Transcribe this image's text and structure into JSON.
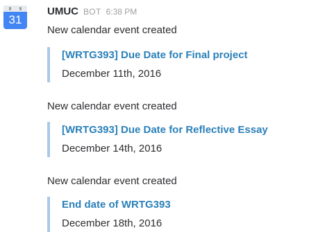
{
  "avatar": {
    "day": "31"
  },
  "header": {
    "sender": "UMUC",
    "bot_badge": "BOT",
    "time": "6:38 PM"
  },
  "messages": [
    {
      "text": "New calendar event created",
      "event_title": "[WRTG393] Due Date for Final project",
      "event_date": "December 11th, 2016"
    },
    {
      "text": "New calendar event created",
      "event_title": "[WRTG393] Due Date for Reflective Essay",
      "event_date": "December 14th, 2016"
    },
    {
      "text": "New calendar event created",
      "event_title": "End date of WRTG393",
      "event_date": "December 18th, 2016"
    }
  ],
  "colors": {
    "link": "#2a80b9",
    "attachment_border": "#a9c9e8",
    "avatar_blue": "#4285f4",
    "muted": "#a0a0a2"
  },
  "icons": {
    "avatar": "google-calendar-icon"
  }
}
